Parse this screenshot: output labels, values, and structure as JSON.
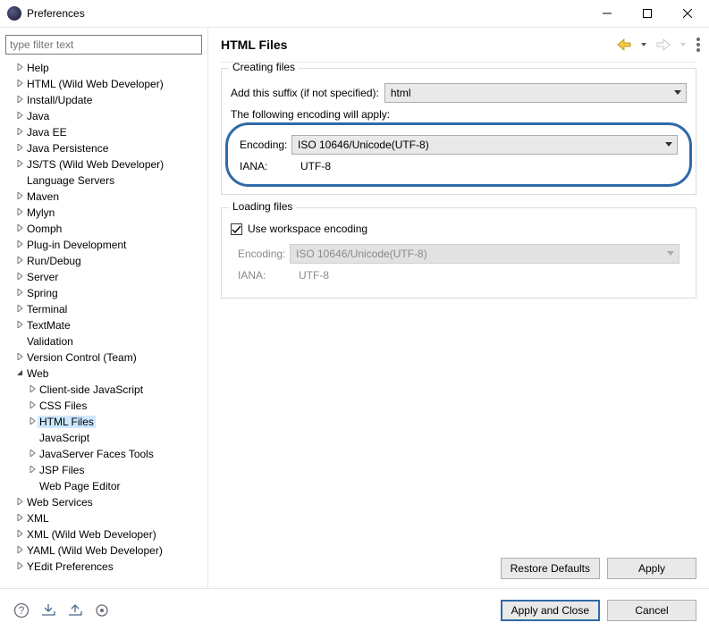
{
  "window": {
    "title": "Preferences"
  },
  "filter": {
    "placeholder": "type filter text"
  },
  "tree": [
    {
      "label": "Help",
      "expandable": true,
      "depth": 0
    },
    {
      "label": "HTML (Wild Web Developer)",
      "expandable": true,
      "depth": 0
    },
    {
      "label": "Install/Update",
      "expandable": true,
      "depth": 0
    },
    {
      "label": "Java",
      "expandable": true,
      "depth": 0
    },
    {
      "label": "Java EE",
      "expandable": true,
      "depth": 0
    },
    {
      "label": "Java Persistence",
      "expandable": true,
      "depth": 0
    },
    {
      "label": "JS/TS (Wild Web Developer)",
      "expandable": true,
      "depth": 0
    },
    {
      "label": "Language Servers",
      "expandable": false,
      "depth": 0
    },
    {
      "label": "Maven",
      "expandable": true,
      "depth": 0
    },
    {
      "label": "Mylyn",
      "expandable": true,
      "depth": 0
    },
    {
      "label": "Oomph",
      "expandable": true,
      "depth": 0
    },
    {
      "label": "Plug-in Development",
      "expandable": true,
      "depth": 0
    },
    {
      "label": "Run/Debug",
      "expandable": true,
      "depth": 0
    },
    {
      "label": "Server",
      "expandable": true,
      "depth": 0
    },
    {
      "label": "Spring",
      "expandable": true,
      "depth": 0
    },
    {
      "label": "Terminal",
      "expandable": true,
      "depth": 0
    },
    {
      "label": "TextMate",
      "expandable": true,
      "depth": 0
    },
    {
      "label": "Validation",
      "expandable": false,
      "depth": 0
    },
    {
      "label": "Version Control (Team)",
      "expandable": true,
      "depth": 0
    },
    {
      "label": "Web",
      "expandable": true,
      "expanded": true,
      "depth": 0
    },
    {
      "label": "Client-side JavaScript",
      "expandable": true,
      "depth": 1
    },
    {
      "label": "CSS Files",
      "expandable": true,
      "depth": 1
    },
    {
      "label": "HTML Files",
      "expandable": true,
      "depth": 1,
      "selected": true
    },
    {
      "label": "JavaScript",
      "expandable": false,
      "depth": 1
    },
    {
      "label": "JavaServer Faces Tools",
      "expandable": true,
      "depth": 1
    },
    {
      "label": "JSP Files",
      "expandable": true,
      "depth": 1
    },
    {
      "label": "Web Page Editor",
      "expandable": false,
      "depth": 1
    },
    {
      "label": "Web Services",
      "expandable": true,
      "depth": 0
    },
    {
      "label": "XML",
      "expandable": true,
      "depth": 0
    },
    {
      "label": "XML (Wild Web Developer)",
      "expandable": true,
      "depth": 0
    },
    {
      "label": "YAML (Wild Web Developer)",
      "expandable": true,
      "depth": 0
    },
    {
      "label": "YEdit Preferences",
      "expandable": true,
      "depth": 0
    }
  ],
  "page": {
    "title": "HTML Files",
    "creating": {
      "legend": "Creating files",
      "suffix_label": "Add this suffix (if not specified):",
      "suffix_value": "html",
      "encoding_note": "The following encoding will apply:",
      "encoding_label": "Encoding:",
      "encoding_value": "ISO 10646/Unicode(UTF-8)",
      "iana_label": "IANA:",
      "iana_value": "UTF-8"
    },
    "loading": {
      "legend": "Loading files",
      "use_workspace": "Use workspace encoding",
      "encoding_label": "Encoding:",
      "encoding_value": "ISO 10646/Unicode(UTF-8)",
      "iana_label": "IANA:",
      "iana_value": "UTF-8"
    },
    "buttons": {
      "restore": "Restore Defaults",
      "apply": "Apply",
      "apply_close": "Apply and Close",
      "cancel": "Cancel"
    }
  }
}
